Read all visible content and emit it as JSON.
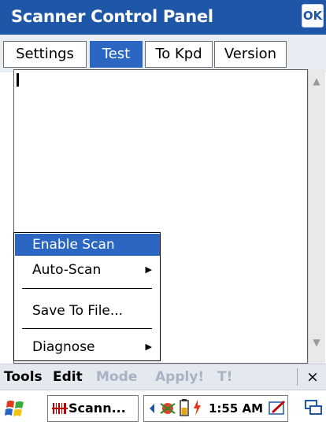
{
  "window": {
    "title": "Scanner Control Panel",
    "ok_label": "OK"
  },
  "tabs": [
    {
      "label": "Settings",
      "active": false
    },
    {
      "label": "Test",
      "active": true
    },
    {
      "label": "To Kpd",
      "active": false
    },
    {
      "label": "Version",
      "active": false
    }
  ],
  "menu": {
    "items": [
      {
        "label": "Enable Scan",
        "highlighted": true,
        "submenu": false
      },
      {
        "label": "Auto-Scan",
        "highlighted": false,
        "submenu": true
      },
      {
        "label": "Save To File...",
        "highlighted": false,
        "submenu": false
      },
      {
        "label": "Diagnose",
        "highlighted": false,
        "submenu": true
      }
    ]
  },
  "command_bar": {
    "items": [
      {
        "label": "Tools",
        "enabled": true
      },
      {
        "label": "Edit",
        "enabled": true
      },
      {
        "label": "Mode",
        "enabled": false
      },
      {
        "label": "Apply!",
        "enabled": false
      },
      {
        "label": "T!",
        "enabled": false
      }
    ],
    "close_label": "×"
  },
  "taskbar": {
    "task_label": "Scann...",
    "clock": "1:55 AM"
  },
  "colors": {
    "title_bar": "#1e56a8",
    "highlight": "#2b66c2",
    "disabled_text": "#a8b2c2"
  }
}
